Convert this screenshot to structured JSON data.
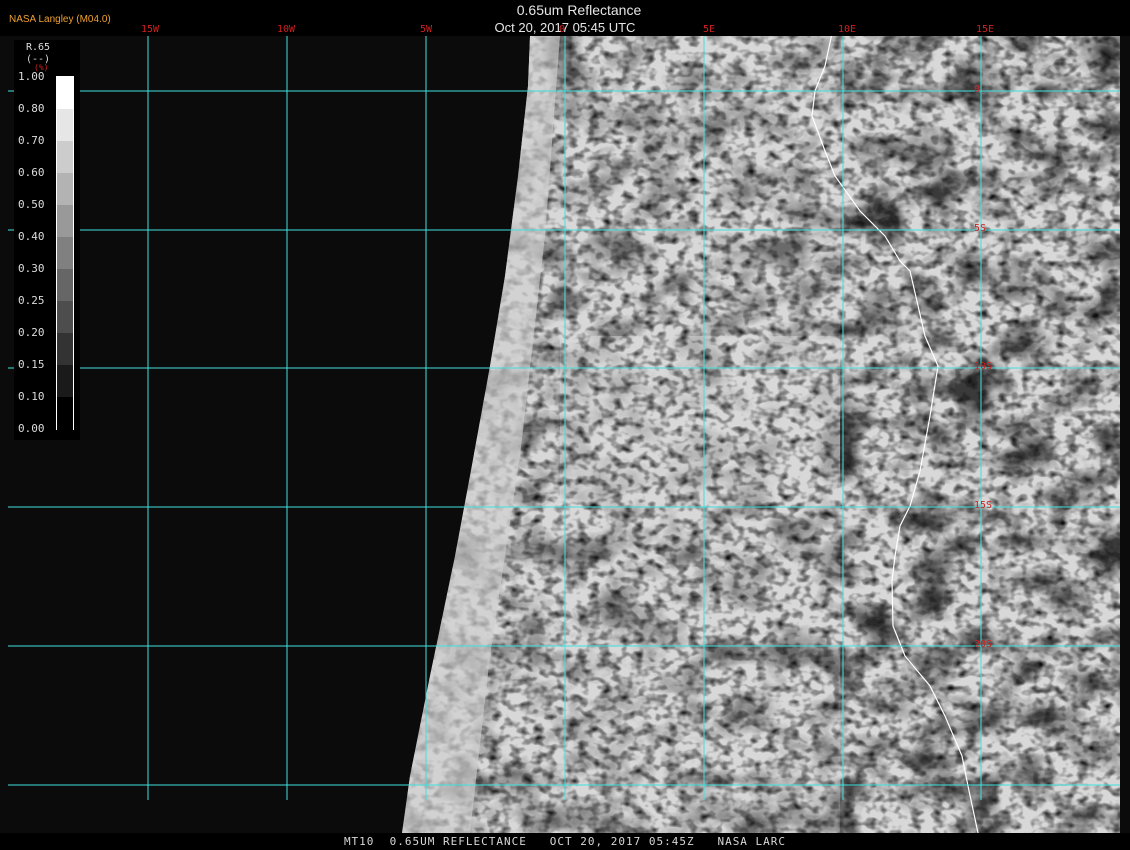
{
  "header": {
    "title": "0.65um Reflectance",
    "datetime": "Oct 20, 2017 05:45 UTC",
    "credit": "NASA Langley (M04.0)"
  },
  "legend": {
    "title": "R.65",
    "units": "(--)",
    "sub": "(%)",
    "ticks": [
      "1.00",
      "0.80",
      "0.70",
      "0.60",
      "0.50",
      "0.40",
      "0.30",
      "0.25",
      "0.20",
      "0.15",
      "0.10",
      "0.00"
    ]
  },
  "map": {
    "lon_labels": [
      "15W",
      "10W",
      "5W",
      "0",
      "5E",
      "10E",
      "15E"
    ],
    "lat_labels": [
      "0",
      "5S",
      "10S",
      "15S",
      "20S"
    ],
    "grid_color": "#40e0e0",
    "coast_color": "#ffffff",
    "label_color": "#d02020"
  },
  "footer": {
    "text": "MT10  0.65UM REFLECTANCE   OCT 20, 2017 05:45Z   NASA LARC"
  }
}
